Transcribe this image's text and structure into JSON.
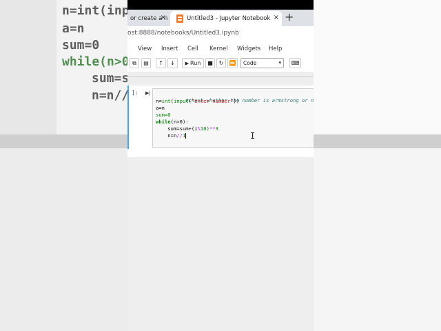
{
  "background": {
    "code_lines": [
      "n=int(inp",
      "a=n",
      "sum=0",
      "while(n>0",
      "sum=su",
      "n=n//"
    ]
  },
  "browser": {
    "tabs": [
      {
        "title": "or create a n",
        "active": false,
        "close": "×"
      },
      {
        "title": "Untitled3 - Jupyter Notebook",
        "active": true,
        "close": "×"
      }
    ],
    "new_tab": "+",
    "url": "ost:8888/notebooks/Untitled3.ipynb"
  },
  "menu": {
    "items": [
      "View",
      "Insert",
      "Cell",
      "Kernel",
      "Widgets",
      "Help"
    ]
  },
  "toolbar": {
    "run_label": "Run",
    "cell_type": "Code"
  },
  "cell": {
    "prompt": "]:",
    "code": {
      "line1": "#check whether the number is armstrong or not",
      "line2_a": "n=",
      "line2_b": "int",
      "line2_c": "(",
      "line2_d": "input",
      "line2_e": "(",
      "line2_f": "\"enter number\"",
      "line2_g": "))",
      "line3": "a=n",
      "line4": "sum=0",
      "line5_a": "while",
      "line5_b": "(n>0):",
      "line6_a": "    sum=sum+(i",
      "line6_b": "%",
      "line6_c": "10)",
      "line6_d": "**",
      "line6_e": "3",
      "line7_a": "    n=n",
      "line7_b": "//",
      "line7_c": "1"
    }
  },
  "colors": {
    "cell_border": "#42a5f5",
    "keyword": "#008000",
    "string": "#ba2121",
    "comment": "#408080"
  }
}
